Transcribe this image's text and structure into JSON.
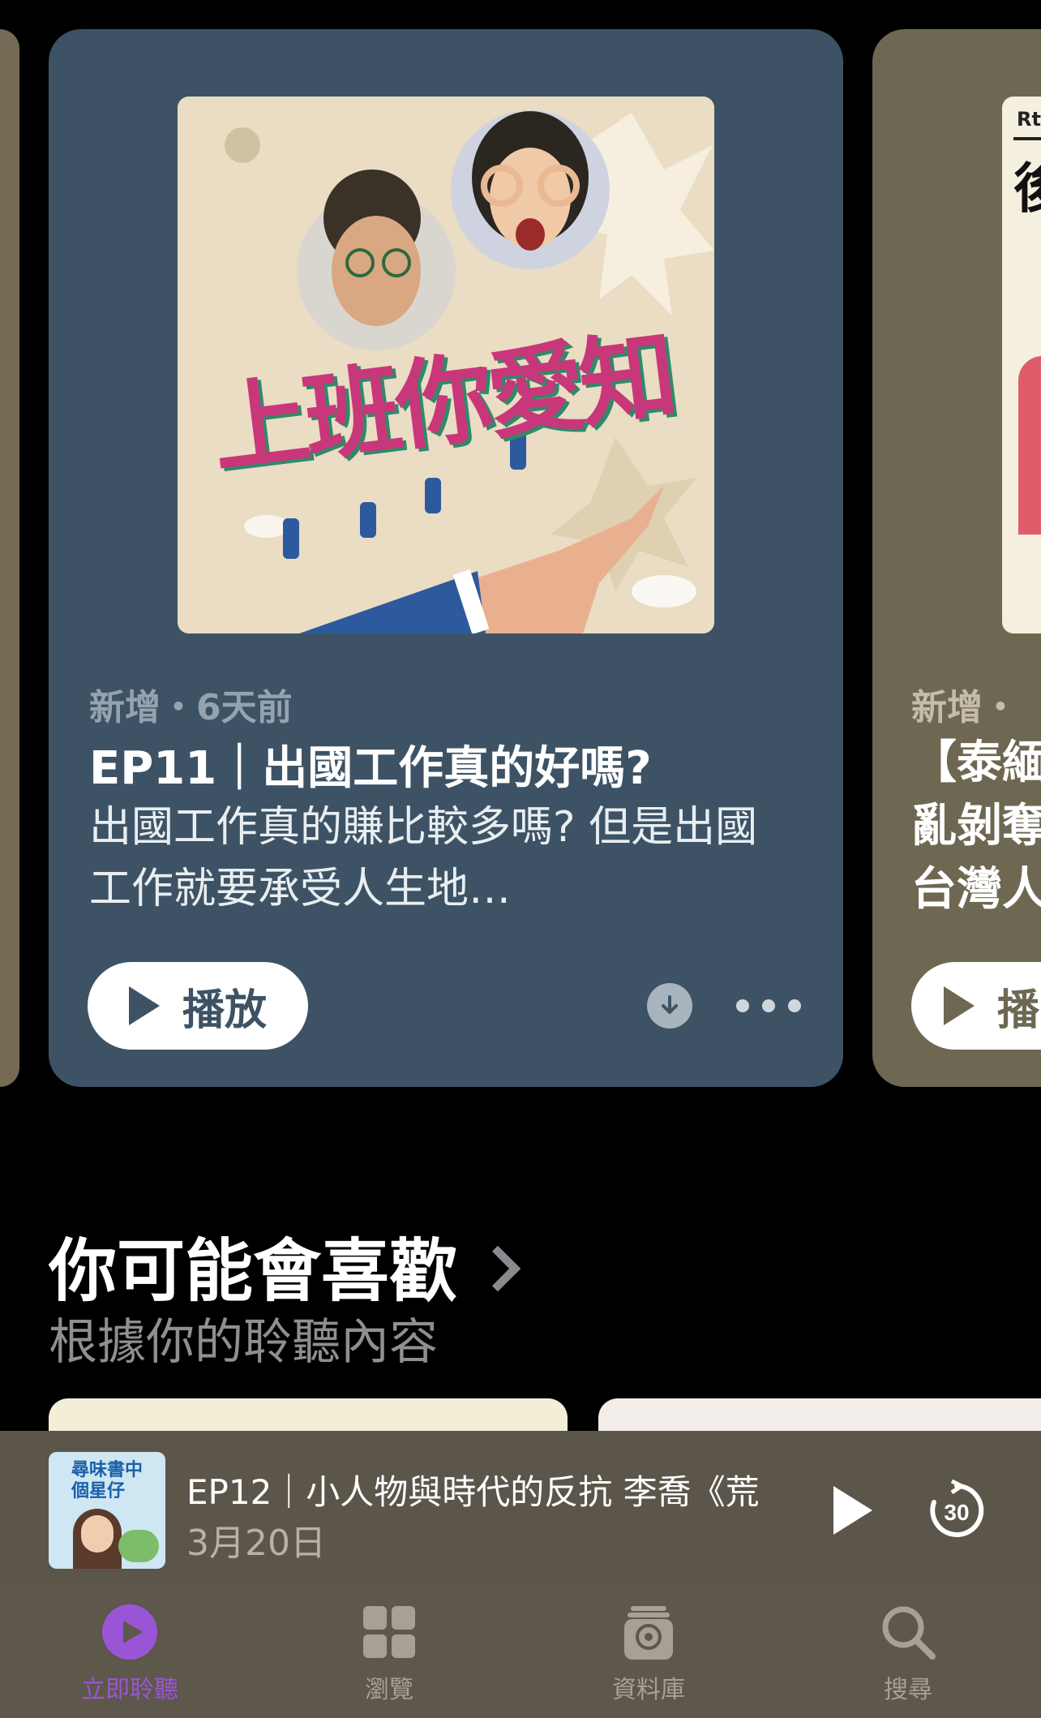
{
  "featured_card": {
    "artwork_title": "上班你愛知",
    "meta": "新增・6天前",
    "episode_title": "EP11｜出國工作真的好嗎?",
    "description": "出國工作真的賺比較多嗎? 但是出國工作就要承受人生地…",
    "play_label": "播放",
    "colors": {
      "card": "#3d5365",
      "accent_title": "#c8377a"
    }
  },
  "next_card": {
    "artwork_text": "Rti",
    "artwork_char": "後",
    "meta": "新增・",
    "title_lines": [
      "【泰緬",
      "亂剝奪",
      "台灣人"
    ],
    "play_label": "播"
  },
  "section": {
    "title": "你可能會喜歡",
    "subtitle": "根據你的聆聽內容"
  },
  "mini_player": {
    "title": "EP12｜小人物與時代的反抗 李喬《荒",
    "date": "3月20日",
    "artwork_text": "尋味書中 個星仔",
    "skip_seconds": "30"
  },
  "tabbar": {
    "items": [
      {
        "label": "立即聆聽",
        "icon": "play-circle-icon",
        "active": true
      },
      {
        "label": "瀏覽",
        "icon": "grid-icon",
        "active": false
      },
      {
        "label": "資料庫",
        "icon": "library-icon",
        "active": false
      },
      {
        "label": "搜尋",
        "icon": "search-icon",
        "active": false
      }
    ],
    "active_color": "#9a55d6"
  }
}
